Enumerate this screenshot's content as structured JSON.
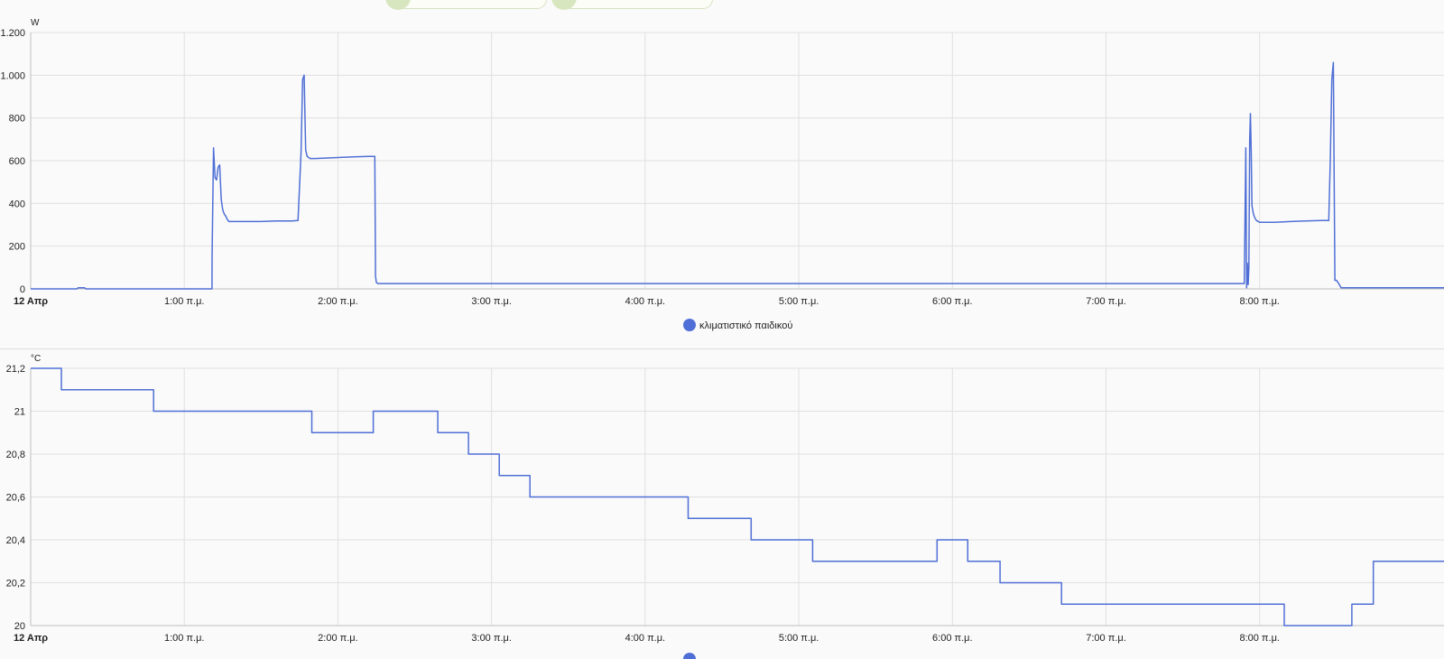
{
  "colors": {
    "series": "#4f6fd6",
    "grid": "#e0e0e0",
    "axis": "#bdbdbd",
    "text": "#212121",
    "background": "#fafafa"
  },
  "chart_data": [
    {
      "type": "line",
      "title": "",
      "unit": "W",
      "ylabel": "",
      "xlabel": "",
      "ylim": [
        0,
        1200
      ],
      "yticks": [
        0,
        200,
        400,
        600,
        800,
        1000,
        1200
      ],
      "ytick_labels": [
        "0",
        "200",
        "400",
        "600",
        "800",
        "1.000",
        "1.200"
      ],
      "xlim_hours": [
        0,
        9.2
      ],
      "xticks": [
        0,
        1,
        2,
        3,
        4,
        5,
        6,
        7,
        8
      ],
      "xtick_labels": [
        "12 Απρ",
        "1:00 π.μ.",
        "2:00 π.μ.",
        "3:00 π.μ.",
        "4:00 π.μ.",
        "5:00 π.μ.",
        "6:00 π.μ.",
        "7:00 π.μ.",
        "8:00 π.μ."
      ],
      "grid": true,
      "legend": "bottom-center",
      "series": [
        {
          "name": "κλιματιστικό παιδικού",
          "step": false,
          "x": [
            0,
            0.3,
            0.31,
            0.35,
            0.36,
            1.18,
            1.181,
            1.19,
            1.2,
            1.21,
            1.22,
            1.23,
            1.24,
            1.25,
            1.26,
            1.27,
            1.28,
            1.29,
            1.3,
            1.32,
            1.34,
            1.4,
            1.5,
            1.6,
            1.7,
            1.74,
            1.76,
            1.77,
            1.78,
            1.79,
            1.8,
            1.81,
            1.82,
            1.85,
            1.9,
            2.0,
            2.1,
            2.2,
            2.24,
            2.245,
            2.25,
            2.26,
            2.27,
            3.0,
            4.0,
            5.0,
            6.0,
            7.0,
            7.9,
            7.91,
            7.915,
            7.92,
            7.925,
            7.93,
            7.935,
            7.94,
            7.945,
            7.95,
            7.96,
            7.97,
            7.98,
            8.0,
            8.1,
            8.2,
            8.3,
            8.4,
            8.45,
            8.46,
            8.47,
            8.48,
            8.49,
            8.5,
            8.51,
            8.53,
            8.54,
            8.55,
            8.6,
            9.0,
            9.2
          ],
          "y": [
            0,
            0,
            5,
            5,
            0,
            0,
            150,
            660,
            520,
            510,
            570,
            580,
            420,
            370,
            350,
            340,
            325,
            315,
            315,
            315,
            315,
            315,
            315,
            318,
            318,
            320,
            640,
            980,
            1000,
            650,
            620,
            615,
            610,
            610,
            612,
            615,
            618,
            620,
            620,
            60,
            30,
            25,
            25,
            25,
            25,
            25,
            25,
            25,
            25,
            660,
            5,
            120,
            20,
            100,
            700,
            820,
            640,
            390,
            350,
            330,
            320,
            312,
            312,
            315,
            318,
            320,
            320,
            600,
            980,
            1060,
            40,
            40,
            30,
            5,
            5,
            5,
            5,
            5,
            5
          ]
        }
      ]
    },
    {
      "type": "line",
      "title": "",
      "unit": "°C",
      "ylabel": "",
      "xlabel": "",
      "ylim": [
        20,
        21.2
      ],
      "yticks": [
        20,
        20.2,
        20.4,
        20.6,
        20.8,
        21,
        21.2
      ],
      "ytick_labels": [
        "20",
        "20,2",
        "20,4",
        "20,6",
        "20,8",
        "21",
        "21,2"
      ],
      "xlim_hours": [
        0,
        9.2
      ],
      "xticks": [
        0,
        1,
        2,
        3,
        4,
        5,
        6,
        7,
        8
      ],
      "xtick_labels": [
        "12 Απρ",
        "1:00 π.μ.",
        "2:00 π.μ.",
        "3:00 π.μ.",
        "4:00 π.μ.",
        "5:00 π.μ.",
        "6:00 π.μ.",
        "7:00 π.μ.",
        "8:00 π.μ."
      ],
      "grid": true,
      "legend": "bottom-center",
      "series": [
        {
          "step": true,
          "x": [
            0,
            0.2,
            0.8,
            1.83,
            2.23,
            2.65,
            2.85,
            3.05,
            3.25,
            4.28,
            4.69,
            5.09,
            5.9,
            6.1,
            6.31,
            6.71,
            8.16,
            8.6,
            8.74,
            9.2
          ],
          "y": [
            21.2,
            21.1,
            21.0,
            20.9,
            21.0,
            20.9,
            20.8,
            20.7,
            20.6,
            20.5,
            20.4,
            20.3,
            20.4,
            20.3,
            20.2,
            20.1,
            20.0,
            20.1,
            20.3,
            20.3
          ]
        }
      ]
    }
  ]
}
